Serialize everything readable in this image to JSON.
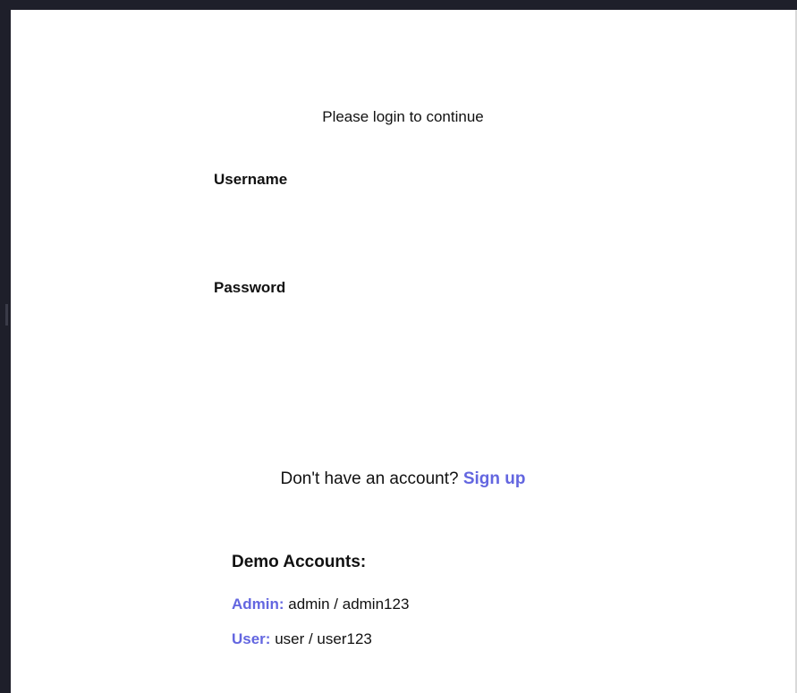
{
  "login": {
    "subtitle": "Please login to continue",
    "username_label": "Username",
    "username_value": "",
    "password_label": "Password",
    "password_value": "",
    "submit_label": ""
  },
  "signup": {
    "prompt": "Don't have an account? ",
    "link_label": "Sign up"
  },
  "demo": {
    "title": "Demo Accounts:",
    "accounts": [
      {
        "role": "Admin:",
        "credentials": " admin / admin123"
      },
      {
        "role": "User:",
        "credentials": " user / user123"
      }
    ]
  },
  "colors": {
    "accent": "#6366e0",
    "text": "#111111",
    "frame": "#1e1f2a",
    "background": "#ffffff"
  }
}
